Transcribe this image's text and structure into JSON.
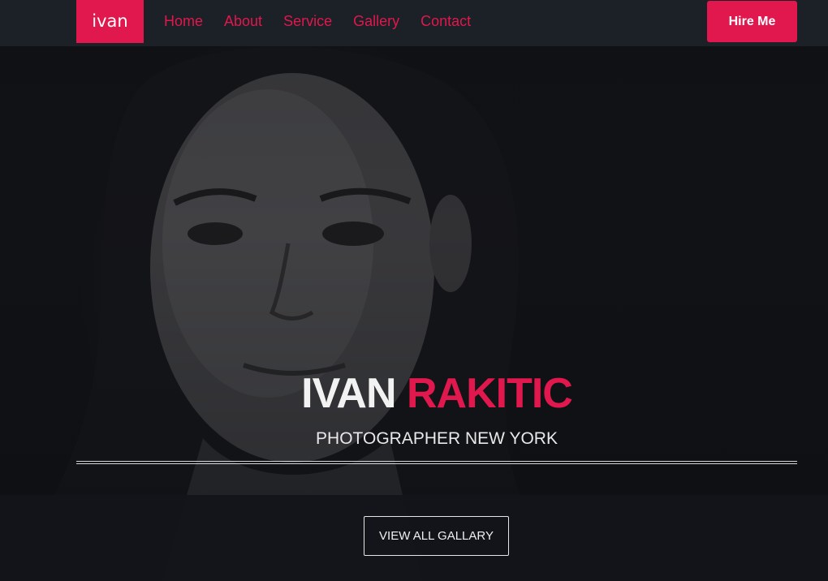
{
  "navbar": {
    "brand": "ivan",
    "links": [
      "Home",
      "About",
      "Service",
      "Gallery",
      "Contact"
    ],
    "hire_button": "Hire Me"
  },
  "hero": {
    "first_name": "IVAN",
    "last_name": "RAKITIC",
    "subtitle": "PHOTOGRAPHER NEW YORK",
    "cta_label": "VIEW ALL GALLARY"
  },
  "colors": {
    "accent": "#e0184d",
    "navbar_bg": "#1c2027",
    "page_bg": "#0f1116"
  }
}
